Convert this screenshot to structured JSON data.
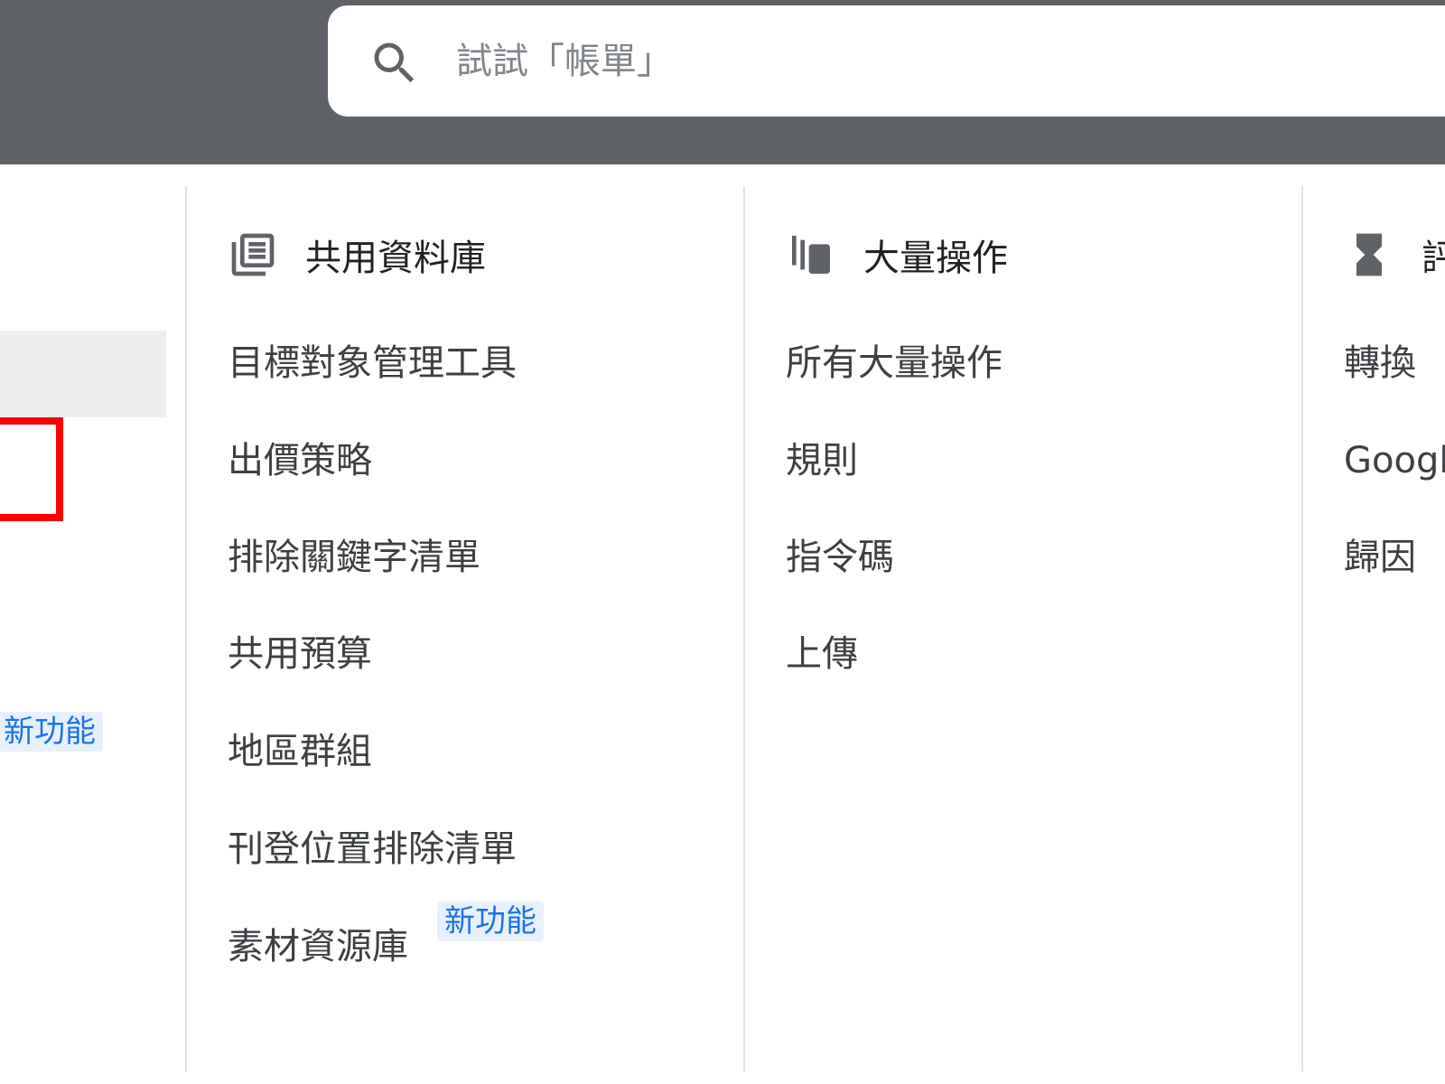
{
  "search": {
    "placeholder": "試試「帳單」"
  },
  "left": {
    "new_badge": "新功能"
  },
  "columns": {
    "shared_library": {
      "title": "共用資料庫",
      "icon": "library-icon",
      "items": [
        "目標對象管理工具",
        "出價策略",
        "排除關鍵字清單",
        "共用預算",
        "地區群組",
        "刊登位置排除清單",
        "素材資源庫"
      ],
      "new_badge": "新功能"
    },
    "bulk_actions": {
      "title": "大量操作",
      "icon": "copy-stack-icon",
      "items": [
        "所有大量操作",
        "規則",
        "指令碼",
        "上傳"
      ]
    },
    "measurement": {
      "title": "評",
      "icon": "hourglass-icon",
      "items": [
        "轉換",
        "Googl",
        "歸因"
      ]
    }
  },
  "colors": {
    "topbar": "#5f6368",
    "badge_bg": "#e8f0fe",
    "badge_text": "#1a73e8",
    "highlight": "#ff0000"
  }
}
